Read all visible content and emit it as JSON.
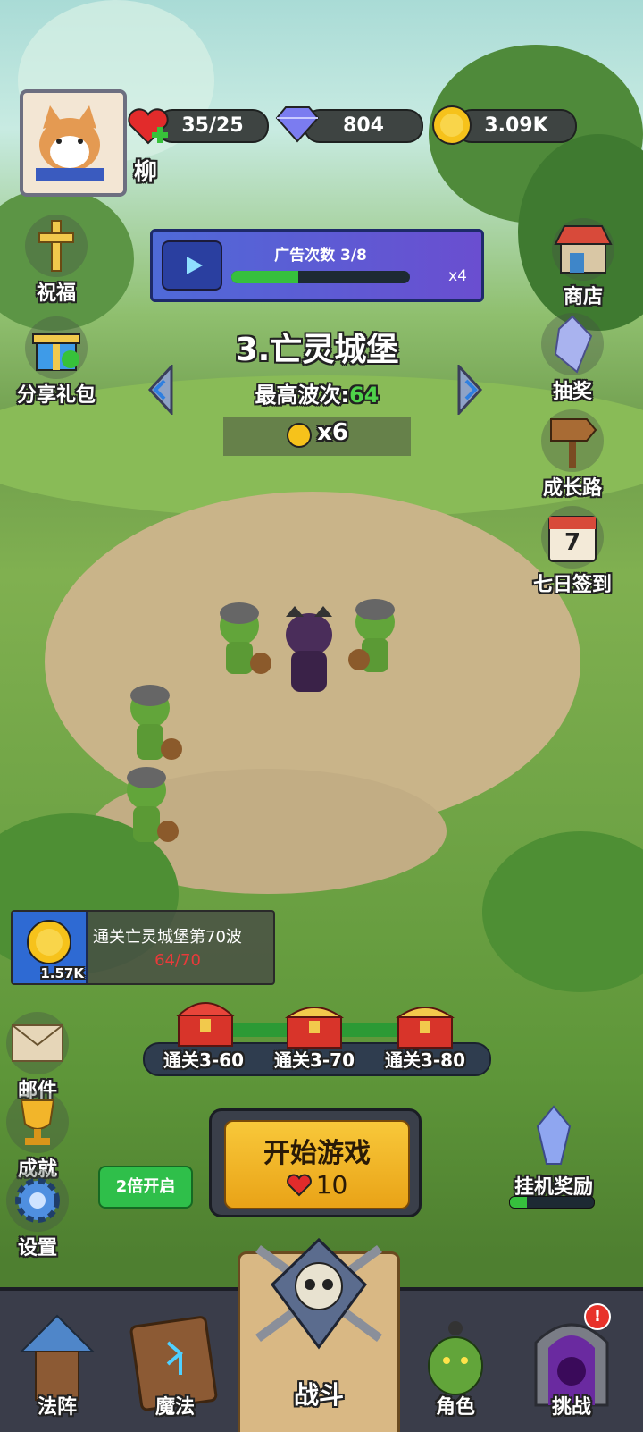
{
  "player": {
    "name": "柳"
  },
  "resources": {
    "hearts": "35/25",
    "gems": "804",
    "coins": "3.09K"
  },
  "ad_panel": {
    "title": "广告次数 3/8",
    "multiplier": "x4",
    "progress": 0.375
  },
  "stage": {
    "name": "3.亡灵城堡",
    "best_wave_label": "最高波次:",
    "best_wave_value": "64",
    "coin_multiplier": "x6"
  },
  "left_menu": {
    "bless": "祝福",
    "share": "分享礼包"
  },
  "right_menu": {
    "shop": "商店",
    "lottery": "抽奖",
    "growth": "成长路",
    "checkin": "七日签到",
    "checkin_day": "7"
  },
  "quest": {
    "title": "通关亡灵城堡第70波",
    "progress": "64/70",
    "reward": "1.57K"
  },
  "chests": [
    {
      "label": "通关3-60"
    },
    {
      "label": "通关3-70"
    },
    {
      "label": "通关3-80"
    }
  ],
  "lower_left": {
    "mail": "邮件",
    "achievements": "成就",
    "settings": "设置"
  },
  "double_button": "2倍开启",
  "start": {
    "label": "开始游戏",
    "cost": "10"
  },
  "idle": {
    "label": "挂机奖励",
    "progress": 0.2
  },
  "nav": {
    "formation": "法阵",
    "magic": "魔法",
    "battle": "战斗",
    "character": "角色",
    "challenge": "挑战"
  },
  "colors": {
    "accent_green": "#35c23b",
    "gold": "#f6c21b",
    "nav_bg": "#3a3d4a",
    "best_wave": "#4fd24a"
  }
}
